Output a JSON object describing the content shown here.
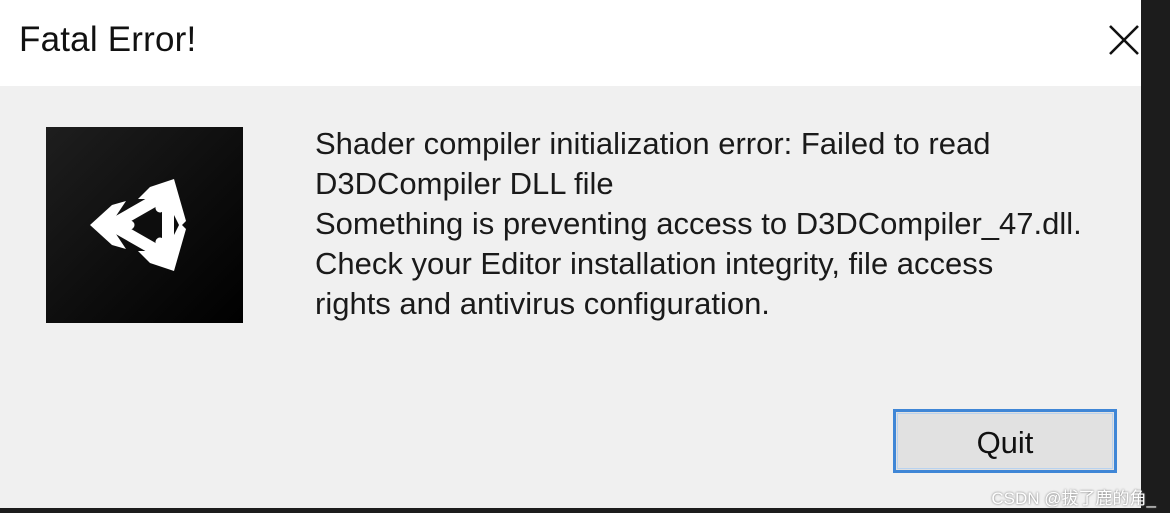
{
  "window": {
    "title": "Fatal Error!",
    "close_icon": "close-icon"
  },
  "logo": {
    "icon": "unity-logo-icon"
  },
  "message": {
    "lines": [
      "Shader compiler initialization error: Failed to read",
      "D3DCompiler DLL file",
      "Something is preventing access to D3DCompiler_47.dll.",
      "Check your Editor installation integrity, file access",
      "rights and antivirus configuration."
    ]
  },
  "buttons": {
    "quit_label": "Quit"
  },
  "watermark": "CSDN @拔了鹿的角_",
  "colors": {
    "dialog_bg": "#f0f0f0",
    "titlebar_bg": "#ffffff",
    "button_focus_border": "#3f86d6",
    "logo_bg": "#000000"
  }
}
